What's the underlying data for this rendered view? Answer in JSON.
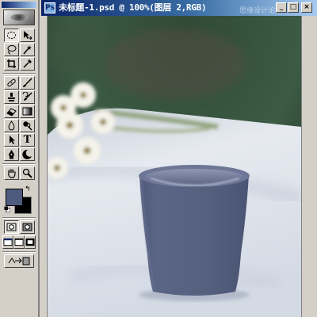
{
  "document": {
    "title": "未标题-1.psd @ 100%(图层 2,RGB)",
    "icon_glyph": "Ps",
    "minimize_label": "_",
    "maximize_label": "□",
    "close_label": "×",
    "watermark": "思缘设计论坛"
  },
  "toolbox": {
    "tools": [
      {
        "name": "marquee-tool",
        "icon": "marquee"
      },
      {
        "name": "move-tool",
        "icon": "move"
      },
      {
        "name": "lasso-tool",
        "icon": "lasso"
      },
      {
        "name": "magic-wand-tool",
        "icon": "wand"
      },
      {
        "name": "crop-tool",
        "icon": "crop"
      },
      {
        "name": "slice-tool",
        "icon": "slice"
      },
      {
        "name": "healing-brush-tool",
        "icon": "bandage"
      },
      {
        "name": "brush-tool",
        "icon": "brush"
      },
      {
        "name": "clone-stamp-tool",
        "icon": "stamp"
      },
      {
        "name": "history-brush-tool",
        "icon": "history-brush"
      },
      {
        "name": "eraser-tool",
        "icon": "eraser"
      },
      {
        "name": "gradient-tool",
        "icon": "gradient"
      },
      {
        "name": "blur-tool",
        "icon": "drop"
      },
      {
        "name": "dodge-tool",
        "icon": "dodge"
      },
      {
        "name": "path-selection-tool",
        "icon": "arrow"
      },
      {
        "name": "type-tool",
        "glyph": "T"
      },
      {
        "name": "pen-tool",
        "icon": "pen"
      },
      {
        "name": "custom-shape-tool",
        "icon": "shape"
      },
      {
        "name": "notes-tool",
        "icon": "note"
      },
      {
        "name": "eyedropper-tool",
        "icon": "eyedropper"
      },
      {
        "name": "hand-tool",
        "icon": "hand"
      },
      {
        "name": "zoom-tool",
        "icon": "zoom"
      }
    ],
    "swap_glyph": "↰",
    "colors": {
      "foreground": "#4e5a7e",
      "background": "#000000"
    }
  },
  "colors": {
    "titlebar": "#0a246a",
    "chrome": "#d4d0c8",
    "cup": "#56607f",
    "tablecloth": "#dfe4ec",
    "background_green": "#2f4a36"
  }
}
